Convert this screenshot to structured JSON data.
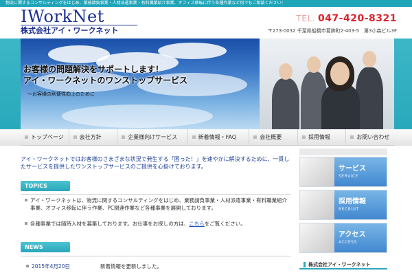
{
  "topbar": {
    "text": "物流に関するコンサルティングをはじめ、業務請負事業・人材派遣事業・有料職業紹介事業、オフィス移転に伴う各種作業など何でもご相談ください！"
  },
  "header": {
    "logo_en": "IWorkNet",
    "logo_jp": "株式会社アイ・ワークネット",
    "tel_label": "TEL.",
    "tel_number": "047-420-8321",
    "address": "〒273-0032 千葉県船橋市葛飾町2-403-5　第3小森ビル3F"
  },
  "hero": {
    "title_line1": "お客様の問題解決をサポートします！",
    "title_line2": "アイ・ワークネットのワンストップサービス",
    "subtitle": "～お客様の利便性向上のために"
  },
  "nav": {
    "items": [
      "トップページ",
      "会社方針",
      "企業様向けサービス",
      "新着情報・FAQ",
      "会社概要",
      "採用情報",
      "お問い合わせ"
    ]
  },
  "intro": {
    "text": "アイ・ワークネットではお客様のさまざまな状況で発生する「困った！」を速やかに解決するために、一貫したサービスを提供したワンストップサービスのご提供を心掛けております。"
  },
  "topics": {
    "heading": "TOPICS",
    "item1": "アイ・ワークネットは、物流に関するコンサルティングをはじめ、業務請負事業・人材派遣事業・有料職業紹介事業、オフィス移転に伴う作業、PC関連作業など各種事業を展開しております。",
    "item2_before": "各種事業では随時人材を募集しております。お仕事をお探しの方は、",
    "item2_link": "こちら",
    "item2_after": "をご覧ください。"
  },
  "news": {
    "heading": "NEWS",
    "date": "2015年4月20日",
    "text": "新着情報を更新しました。"
  },
  "sidebar": {
    "service_label": "サービス",
    "service_en": "SERVICE",
    "recruit_label": "採用情報",
    "recruit_en": "RECRUIT",
    "access_label": "アクセス",
    "access_en": "ACCESS",
    "company": "株式会社アイ・ワークネット"
  },
  "colors": {
    "brand_teal": "#2aa7bb",
    "brand_navy": "#1c2f8f",
    "tel_red": "#d8242e",
    "side_blue": "#3f86cf"
  }
}
